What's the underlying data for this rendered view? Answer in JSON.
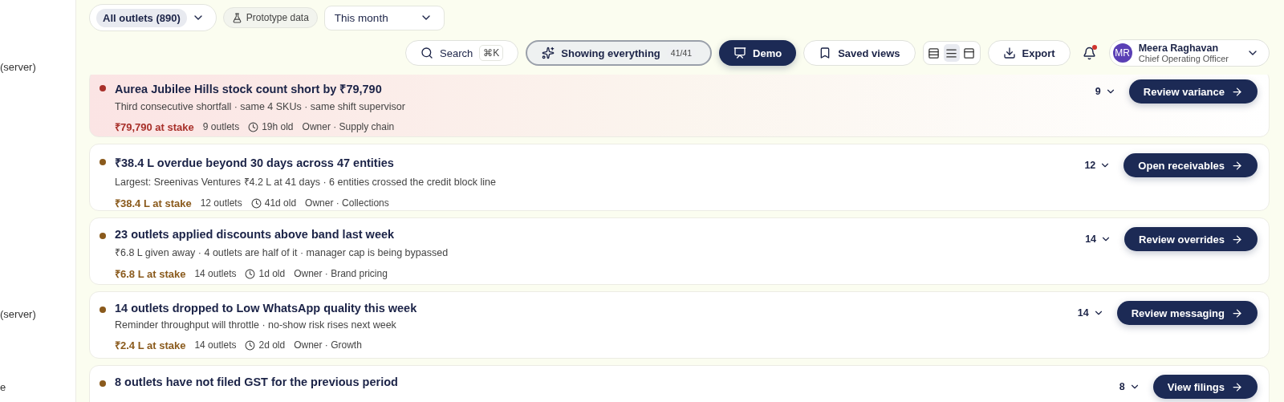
{
  "sidebar": {
    "items": [
      {
        "label": "(server)"
      },
      {
        "label": "(server)"
      },
      {
        "label": "e"
      }
    ]
  },
  "filters": {
    "outlets": "All outlets (890)",
    "badge": "Prototype data",
    "period": "This month"
  },
  "toolbar": {
    "search": {
      "label": "Search",
      "shortcut": "⌘K"
    },
    "scope": {
      "label": "Showing everything",
      "count": "41/41"
    },
    "demo": {
      "label": "Demo",
      "on": true
    },
    "saved_views": "Saved views",
    "density": [
      {
        "kind": "rows",
        "selected": false
      },
      {
        "kind": "list",
        "selected": true
      },
      {
        "kind": "split",
        "selected": false
      }
    ],
    "export": "Export",
    "notifications": {
      "unread": true
    },
    "user": {
      "initials": "MR",
      "name": "Meera Raghavan",
      "role": "Chief Operating Officer"
    }
  },
  "alerts": [
    {
      "color": "#a8302a",
      "highlighted": true,
      "title": "Aurea Jubilee Hills stock count short by ₹79,790",
      "detail": "Third consecutive shortfall · same 4 SKUs · same shift supervisor",
      "stake": "₹79,790 at stake",
      "outlets": "9 outlets",
      "age": "19h old",
      "owner": "Owner · Supply chain",
      "count": "9",
      "action": "Review variance"
    },
    {
      "color": "#8a5a1c",
      "highlighted": false,
      "title": "₹38.4 L overdue beyond 30 days across 47 entities",
      "detail": "Largest: Sreenivas Ventures ₹4.2 L at 41 days · 6 entities crossed the credit block line",
      "stake": "₹38.4 L at stake",
      "outlets": "12 outlets",
      "age": "41d old",
      "owner": "Owner · Collections",
      "count": "12",
      "action": "Open receivables"
    },
    {
      "color": "#8a5a1c",
      "highlighted": false,
      "title": "23 outlets applied discounts above band last week",
      "detail": "₹6.8 L given away · 4 outlets are half of it · manager cap is being bypassed",
      "stake": "₹6.8 L at stake",
      "outlets": "14 outlets",
      "age": "1d old",
      "owner": "Owner · Brand pricing",
      "count": "14",
      "action": "Review overrides"
    },
    {
      "color": "#8a5a1c",
      "highlighted": false,
      "title": "14 outlets dropped to Low WhatsApp quality this week",
      "detail": "Reminder throughput will throttle · no-show risk rises next week",
      "stake": "₹2.4 L at stake",
      "outlets": "14 outlets",
      "age": "2d old",
      "owner": "Owner · Growth",
      "count": "14",
      "action": "Review messaging"
    },
    {
      "color": "#8a5a1c",
      "highlighted": false,
      "title": "8 outlets have not filed GST for the previous period",
      "count": "8",
      "action": "View filings"
    }
  ]
}
